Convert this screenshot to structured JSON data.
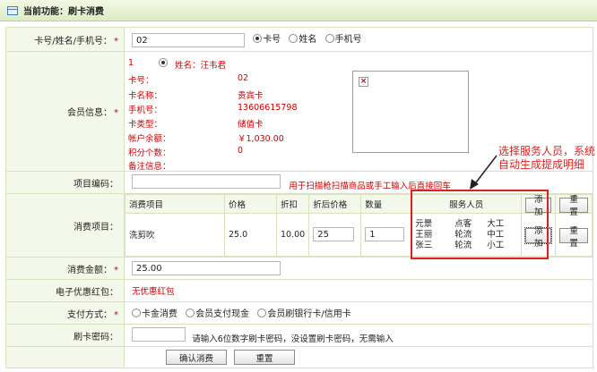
{
  "header": {
    "title": "当前功能：刷卡消费"
  },
  "search": {
    "label": "卡号/姓名/手机号：",
    "value": "02",
    "options": [
      "卡号",
      "姓名",
      "手机号"
    ]
  },
  "member": {
    "label": "会员信息：",
    "index": "1",
    "name_label": "姓名：",
    "name": "汪韦君",
    "fields": [
      {
        "label": "卡号：",
        "value": "02"
      },
      {
        "label": "卡名称：",
        "value": "贵宾卡"
      },
      {
        "label": "手机号：",
        "value": "13606615798"
      },
      {
        "label": "卡类型：",
        "value": "储值卡"
      },
      {
        "label": "帐户余额：",
        "value": "￥1,030.00"
      },
      {
        "label": "积分个数：",
        "value": "0"
      },
      {
        "label": "备注信息：",
        "value": ""
      }
    ]
  },
  "item_code": {
    "label": "项目编码：",
    "value": "",
    "hint": "用于扫描枪扫描商品或手工输入后直接回车"
  },
  "items": {
    "label": "消费项目：",
    "headers": [
      "消费项目",
      "价格",
      "折扣",
      "折后价格",
      "数量",
      "服务人员"
    ],
    "add_label": "添加",
    "reset_label": "重置",
    "row": {
      "name": "洗剪吹",
      "price": "25.0",
      "discount": "10.00",
      "after_price": "25",
      "qty": "1",
      "staff": [
        [
          "元景",
          "点客",
          "大工"
        ],
        [
          "王丽",
          "轮流",
          "中工"
        ],
        [
          "张三",
          "轮流",
          "小工"
        ]
      ]
    }
  },
  "amount": {
    "label": "消费金额：",
    "value": "25.00"
  },
  "coupon": {
    "label": "电子优惠红包：",
    "value": "无优惠红包"
  },
  "payment": {
    "label": "支付方式：",
    "options": [
      "卡金消费",
      "会员支付现金",
      "会员刷银行卡/信用卡"
    ]
  },
  "password": {
    "label": "刷卡密码：",
    "value": "",
    "hint": "请输入6位数字刷卡密码，没设置刷卡密码，无需输入"
  },
  "actions": {
    "confirm": "确认消费",
    "reset": "重置"
  },
  "annotation": {
    "text": "选择服务人员，系统自动生成提成明细"
  },
  "colors": {
    "required": "#cc0000",
    "annotation": "#e02020",
    "label_bg": "#f4f8ea"
  }
}
